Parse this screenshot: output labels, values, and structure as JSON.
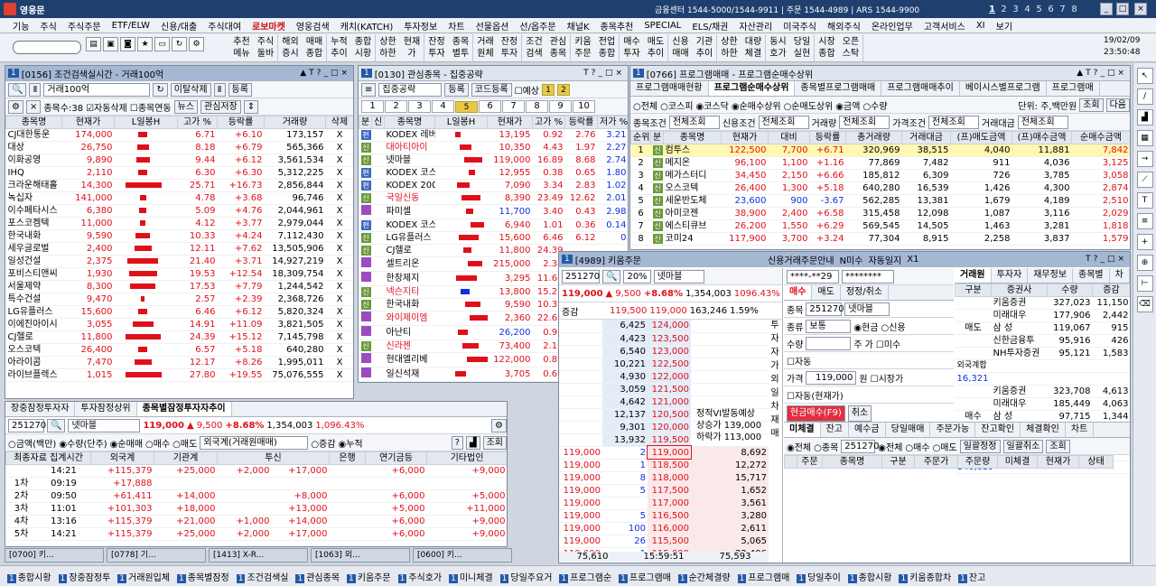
{
  "app": {
    "title": "영웅문",
    "center_text": "금융센터 1544-5000/1544-9911 | 주문 1544-4989 | ARS 1544-9900",
    "pages": [
      "1",
      "2",
      "3",
      "4",
      "5",
      "6",
      "7",
      "8"
    ]
  },
  "menu": [
    "기능",
    "주식",
    "주식주문",
    "ETF/ELW",
    "신용/대출",
    "주식대여",
    "로보마켓",
    "영웅검색",
    "캐치(KATCH)",
    "투자정보",
    "차트",
    "선물옵션",
    "선/옵주문",
    "채널K",
    "종목추천",
    "SPECIAL",
    "ELS/채권",
    "자산관리",
    "미국주식",
    "해외주식",
    "온라인업무",
    "고객서비스",
    "XI",
    "보기"
  ],
  "toolbar": {
    "buttons": [
      "추천\n메뉴",
      "주식\n둘바",
      "해외\n증시",
      "매매\n종합",
      "누적\n추이",
      "종합\n시황",
      "상한\n하한",
      "현재\n가",
      "잔정\n투자",
      "종목\n별투",
      "거래\n원체",
      "잔정\n투자",
      "조건\n검색",
      "관심\n종목",
      "키움\n주문",
      "전업\n종합",
      "매수\n투자",
      "매도\n추이",
      "신용\n매매",
      "기관\n추이",
      "상한\n하한",
      "대량\n체결",
      "동시\n호가",
      "당일\n실현",
      "시장\n종합",
      "오픈\n스탁"
    ],
    "date": "19/02/09",
    "time": "23:50:48"
  },
  "win0156": {
    "num": "1",
    "title": "[0156] 조건검색실시간 - 거래100억",
    "condition": "거래100억",
    "btn_delete": "이탈삭제",
    "btn_register": "등록",
    "count_label": "종목수:38",
    "chk_auto_delete": "자동삭제",
    "chk_link": "종목연동",
    "btn_news": "뉴스",
    "btn_save": "관심저장",
    "headers": [
      "종목명",
      "현재가",
      "L일봉H",
      "고가 %",
      "등락률",
      "거래량",
      "삭제"
    ],
    "rows": [
      [
        "CJ대한통운",
        "174,000",
        "6.71",
        "+6.10",
        "173,157",
        "X"
      ],
      [
        "대상",
        "26,750",
        "8.18",
        "+6.79",
        "565,366",
        "X"
      ],
      [
        "이화공영",
        "9,890",
        "9.44",
        "+6.12",
        "3,561,534",
        "X"
      ],
      [
        "IHQ",
        "2,110",
        "6.30",
        "+6.30",
        "5,312,225",
        "X"
      ],
      [
        "크라운해태홀",
        "14,300",
        "25.71",
        "+16.73",
        "2,856,844",
        "X"
      ],
      [
        "녹십자",
        "141,000",
        "4.78",
        "+3.68",
        "96,746",
        "X"
      ],
      [
        "이수페타시스",
        "6,380",
        "5.09",
        "+4.76",
        "2,044,961",
        "X"
      ],
      [
        "포스코켐텍",
        "11,000",
        "4.12",
        "+3.77",
        "2,979,044",
        "X"
      ],
      [
        "한국내화",
        "9,590",
        "10.33",
        "+4.24",
        "7,112,430",
        "X"
      ],
      [
        "세우글로벌",
        "2,400",
        "12.11",
        "+7.62",
        "13,505,906",
        "X"
      ],
      [
        "일성건설",
        "2,375",
        "21.40",
        "+3.71",
        "14,927,219",
        "X"
      ],
      [
        "포비스티앤씨",
        "1,930",
        "19.53",
        "+12.54",
        "18,309,754",
        "X"
      ],
      [
        "서울제약",
        "8,300",
        "17.53",
        "+7.79",
        "1,244,542",
        "X"
      ],
      [
        "특수건설",
        "9,470",
        "2.57",
        "+2.39",
        "2,368,726",
        "X"
      ],
      [
        "LG유플러스",
        "15,600",
        "6.46",
        "+6.12",
        "5,820,324",
        "X"
      ],
      [
        "이에진아이시",
        "3,055",
        "14.91",
        "+11.09",
        "3,821,505",
        "X"
      ],
      [
        "CJ헬로",
        "11,800",
        "24.39",
        "+15.12",
        "7,145,798",
        "X"
      ],
      [
        "오스코텍",
        "26,400",
        "6.57",
        "+5.18",
        "640,280",
        "X"
      ],
      [
        "아라이콤",
        "7,470",
        "12.17",
        "+8.26",
        "1,995,011",
        "X"
      ],
      [
        "라이브플렉스",
        "1,015",
        "27.80",
        "+19.55",
        "75,076,555",
        "X"
      ]
    ]
  },
  "win0130": {
    "num": "1",
    "title": "[0130] 관심종목 - 집중공략",
    "group": "집중공략",
    "btn_register": "등록",
    "btn_code": "코드등록",
    "chk_expect": "예상",
    "tabs": [
      "1",
      "2",
      "3",
      "4",
      "5",
      "6",
      "7",
      "8",
      "9",
      "10"
    ],
    "headers": [
      "분",
      "신",
      "종목명",
      "L일봉H",
      "현재가",
      "고가 %",
      "등락률",
      "저가 %"
    ],
    "rows": [
      [
        "편",
        "",
        "KODEX 레버",
        "13,195",
        "0.92",
        "2.76",
        "3.21"
      ],
      [
        "신",
        "",
        "대아티아이",
        "10,350",
        "4.43",
        "1.97",
        "2.27"
      ],
      [
        "신",
        "",
        "넷마블",
        "119,000",
        "16.89",
        "8.68",
        "2.74"
      ],
      [
        "편",
        "",
        "KODEX 코스",
        "12,955",
        "0.38",
        "0.65",
        "1.80"
      ],
      [
        "편",
        "",
        "KODEX 200",
        "7,090",
        "3.34",
        "2.83",
        "1.02"
      ],
      [
        "신",
        "",
        "국일신동",
        "8,390",
        "23.49",
        "12.62",
        "2.01"
      ],
      [
        "",
        "",
        "파미셀",
        "11,700",
        "3.40",
        "0.43",
        "2.98"
      ],
      [
        "편",
        "",
        "KODEX 코스",
        "6,940",
        "1.01",
        "0.36",
        "0.14"
      ],
      [
        "신",
        "",
        "LG유플러스",
        "15,600",
        "6.46",
        "6.12",
        "0"
      ],
      [
        "신",
        "",
        "CJ헬로",
        "11,800",
        "24.39",
        "",
        ""
      ],
      [
        "",
        "",
        "셀트리온",
        "215,000",
        "2.34",
        "",
        ""
      ],
      [
        "",
        "",
        "한창제지",
        "3,295",
        "11.64",
        "",
        ""
      ],
      [
        "신",
        "",
        "넥슨지티",
        "13,800",
        "15.27",
        "",
        ""
      ],
      [
        "신",
        "",
        "한국내화",
        "9,590",
        "10.33",
        "",
        ""
      ],
      [
        "",
        "",
        "와이제이엠",
        "2,360",
        "22.65",
        "",
        ""
      ],
      [
        "",
        "",
        "아난티",
        "26,200",
        "0.95",
        "",
        ""
      ],
      [
        "신",
        "",
        "신라젠",
        "73,400",
        "2.19",
        "",
        ""
      ],
      [
        "",
        "",
        "현대엘리베",
        "122,000",
        "0.81",
        "",
        ""
      ],
      [
        "",
        "",
        "일신석재",
        "3,705",
        "0.66",
        "",
        ""
      ]
    ]
  },
  "win0766": {
    "num": "1",
    "title": "[0766] 프로그램매매 - 프로그램순매수상위",
    "tabs": [
      "프로그램매매현황",
      "프로그램순매수상위",
      "종목별프로그램매매",
      "프로그램매매추이",
      "베이시스별프로그램",
      "프로그램매"
    ],
    "opts": [
      "전체",
      "코스피",
      "코스닥",
      "순매수상위",
      "순매도상위",
      "금액",
      "수량"
    ],
    "unit": "단위: 주,백만원",
    "btn_query": "조회",
    "btn_next": "다음",
    "filters": [
      "종목조건",
      "전체조회",
      "신용조건",
      "전체조회",
      "거래량",
      "전체조회",
      "가격조건",
      "전체조회",
      "거래대금",
      "전체조회"
    ],
    "headers": [
      "순위",
      "분",
      "종목명",
      "현재가",
      "대비",
      "등락률",
      "총거래량",
      "거래대금",
      "(프)매도금액",
      "(프)매수금액",
      "순매수금액"
    ],
    "rows": [
      [
        "1",
        "신",
        "컴투스",
        "122,500",
        "7,700",
        "+6.71",
        "320,969",
        "38,515",
        "4,040",
        "11,881",
        "7,842"
      ],
      [
        "2",
        "신",
        "메지온",
        "96,100",
        "1,100",
        "+1.16",
        "77,869",
        "7,482",
        "911",
        "4,036",
        "3,125"
      ],
      [
        "3",
        "신",
        "메가스터디",
        "34,450",
        "2,150",
        "+6.66",
        "185,812",
        "6,309",
        "726",
        "3,785",
        "3,058"
      ],
      [
        "4",
        "신",
        "오스코텍",
        "26,400",
        "1,300",
        "+5.18",
        "640,280",
        "16,539",
        "1,426",
        "4,300",
        "2,874"
      ],
      [
        "5",
        "신",
        "세운반도체",
        "23,600",
        "900",
        "-3.67",
        "562,285",
        "13,381",
        "1,679",
        "4,189",
        "2,510"
      ],
      [
        "6",
        "신",
        "아미코젠",
        "38,900",
        "2,400",
        "+6.58",
        "315,458",
        "12,098",
        "1,087",
        "3,116",
        "2,029"
      ],
      [
        "7",
        "신",
        "에스티큐브",
        "26,200",
        "1,550",
        "+6.29",
        "569,545",
        "14,505",
        "1,463",
        "3,281",
        "1,818"
      ],
      [
        "8",
        "신",
        "코미24",
        "117,900",
        "3,700",
        "+3.24",
        "77,304",
        "8,915",
        "2,258",
        "3,837",
        "1,579"
      ]
    ]
  },
  "win4989": {
    "num": "1",
    "title": "[4989] 키움주문",
    "code": "251270",
    "rate_badge": "20%",
    "name": "넷마블",
    "price": "119,000",
    "change": "9,500",
    "pct": "+8.68%",
    "volume": "1,354,003",
    "vol_pct": "1096.43%",
    "sub_a": "119,500",
    "sub_b": "119,000",
    "sub_c": "163,246",
    "sub_d": "1.59%",
    "label_jung": "증감",
    "asks": [
      [
        "6,425",
        "124,000"
      ],
      [
        "4,423",
        "123,500"
      ],
      [
        "6,540",
        "123,000"
      ],
      [
        "10,221",
        "122,500"
      ],
      [
        "4,930",
        "122,000"
      ],
      [
        "3,059",
        "121,500"
      ],
      [
        "4,642",
        "121,000"
      ],
      [
        "12,137",
        "120,500"
      ],
      [
        "9,301",
        "120,000"
      ],
      [
        "13,932",
        "119,500"
      ]
    ],
    "bids": [
      [
        "119,000",
        "2",
        "119,000",
        "8,692"
      ],
      [
        "119,000",
        "1",
        "118,500",
        "12,272"
      ],
      [
        "119,000",
        "8",
        "118,000",
        "15,717"
      ],
      [
        "119,000",
        "5",
        "117,500",
        "1,652"
      ],
      [
        "119,000",
        "",
        "117,000",
        "3,561"
      ],
      [
        "119,000",
        "5",
        "116,500",
        "3,280"
      ],
      [
        "119,000",
        "100",
        "116,000",
        "2,611"
      ],
      [
        "119,000",
        "26",
        "115,500",
        "5,065"
      ],
      [
        "119,000",
        "1",
        "115,000",
        "22,406"
      ],
      [
        "119,000",
        "84",
        "114,500",
        "1,004"
      ]
    ],
    "vi": "정적VI발동예상",
    "up_label": "상승가",
    "up_val": "139,000",
    "down_label": "하락가",
    "down_val": "113,000",
    "total_ask": "75,610",
    "time": "15:59:51",
    "total_bid": "75,593",
    "side_tabs": [
      "투",
      "자",
      "자",
      "가",
      "외",
      "일",
      "차",
      "재",
      "매"
    ],
    "account": "****-**29",
    "password": "********",
    "pwd_label": "신용거래주문안내",
    "lbl_n": "N미수",
    "lbl_auto": "자동일지",
    "lbl_x1": "X1",
    "order_tabs": [
      "매수",
      "매도",
      "정정/취소"
    ],
    "lbl_stock": "종목",
    "lbl_type": "종류",
    "type_val": "보통",
    "lbl_cash": "현금",
    "lbl_credit": "신용",
    "lbl_qty": "수량",
    "lbl_unit": "주",
    "lbl_pct": "가",
    "lbl_misu": "미수",
    "lbl_auto2": "자동",
    "lbl_price": "가격",
    "order_price": "119,000",
    "lbl_won": "원",
    "lbl_market": "시장가",
    "lbl_auto3": "자동(현재가)",
    "btn_buy": "현금매수(F9)",
    "btn_cancel": "취소",
    "broker_tabs": [
      "거래원",
      "투자자",
      "재무정보",
      "종목별"
    ],
    "btn_chart": "차",
    "lbl_gubun": "구분",
    "lbl_firm": "증권사",
    "lbl_qtyh": "수량",
    "lbl_chg": "증감",
    "sell_label": "매도",
    "buy_label": "매수",
    "foreign_label": "외국계합",
    "foreign_sell": "16,321",
    "foreign_buy": "140,053",
    "sellers": [
      [
        "키움증권",
        "327,023",
        "11,150"
      ],
      [
        "미래대우",
        "177,906",
        "2,442"
      ],
      [
        "삼 성",
        "119,067",
        "915"
      ],
      [
        "신한금융투",
        "95,916",
        "426"
      ],
      [
        "NH투자증권",
        "95,121",
        "1,583"
      ]
    ],
    "buyers": [
      [
        "키움증권",
        "323,708",
        "4,613"
      ],
      [
        "미래대우",
        "185,449",
        "4,063"
      ],
      [
        "삼 성",
        "97,715",
        "1,344"
      ],
      [
        "신한금융투",
        "79,974",
        "139"
      ],
      [
        "모건스탠리",
        "72,329",
        "1,556"
      ]
    ],
    "bottom_tabs": [
      "미체결",
      "잔고",
      "예수금",
      "당일매매",
      "주문가능",
      "잔고확인",
      "체결확인",
      "차트"
    ],
    "bopts": [
      "전체",
      "종목",
      "전체",
      "매수",
      "매도"
    ],
    "btn_modify": "일괄정정",
    "btn_cancel_all": "일괄취소",
    "btn_query": "조회",
    "bheaders": [
      "주문",
      "종목명",
      "구분",
      "주문가",
      "주문량",
      "미체결",
      "현재가",
      "상태"
    ]
  },
  "winInv": {
    "tabs": [
      "장중잠정투자자",
      "투자잠정상위",
      "종목별잠정투자자추이"
    ],
    "code": "251270",
    "name": "넷마블",
    "price": "119,000",
    "change": "9,500",
    "pct": "+8.68%",
    "volume": "1,354,003",
    "vpct": "1,096.43%",
    "opt_a": [
      "금액(백만)",
      "수량(단주)",
      "순매매",
      "매수",
      "매도"
    ],
    "select": "외국계(거래원매매)",
    "opt_b": [
      "증감",
      "누적"
    ],
    "btn_query": "조회",
    "headers": [
      "최종자료 집계시간",
      "외국계",
      "기관계",
      "투신",
      "은행",
      "연기금등",
      "기타법인"
    ],
    "rows": [
      [
        "",
        "14:21",
        "+115,379",
        "+25,000",
        "+2,000",
        "+17,000",
        "",
        "+6,000",
        "+9,000"
      ],
      [
        "1차",
        "09:19",
        "+17,888",
        "",
        "",
        "",
        "",
        "",
        ""
      ],
      [
        "2차",
        "09:50",
        "+61,411",
        "+14,000",
        "",
        "+8,000",
        "",
        "+6,000",
        "+5,000"
      ],
      [
        "3차",
        "11:01",
        "+101,303",
        "+18,000",
        "",
        "+13,000",
        "",
        "+5,000",
        "+11,000"
      ],
      [
        "4차",
        "13:16",
        "+115,379",
        "+21,000",
        "+1,000",
        "+14,000",
        "",
        "+6,000",
        "+9,000"
      ],
      [
        "5차",
        "14:21",
        "+115,379",
        "+25,000",
        "+2,000",
        "+17,000",
        "",
        "+6,000",
        "+9,000"
      ]
    ]
  },
  "minimized": [
    "[0700] 키...",
    "[0778] 기...",
    "[1413] X-R...",
    "[1063] 외...",
    "[0600] 키..."
  ],
  "taskbar": [
    "종합시황",
    "장중잠정투",
    "거래원입체",
    "종목별잠정",
    "조건검색실",
    "관심종목",
    "키움주문",
    "주식호가",
    "미니체결",
    "당일주요거",
    "프로그램순",
    "프로그램매",
    "순간체결량",
    "프로그램매",
    "당일추이",
    "종합시황",
    "키움종합차",
    "잔고"
  ],
  "colors": {
    "up": "#e0101a",
    "down": "#1030e0",
    "title": "#1f3f6f"
  }
}
